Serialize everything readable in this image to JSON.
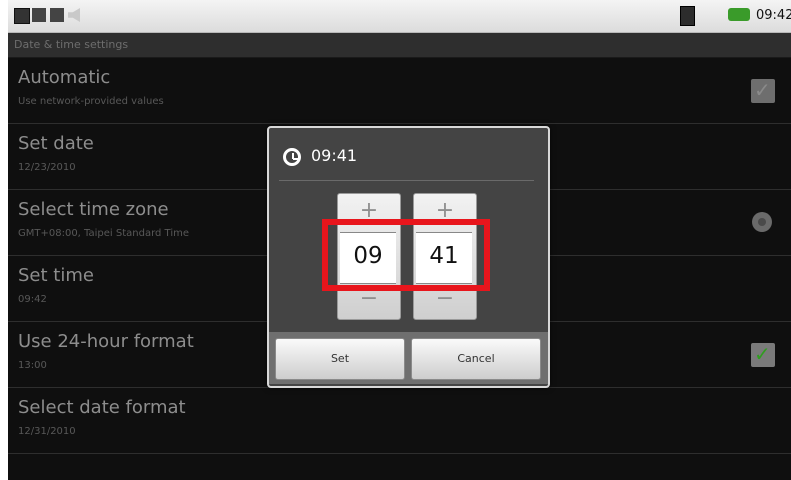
{
  "status_bar": {
    "time": "09:42",
    "icons": [
      "notification-icon",
      "usb-icon",
      "usb-debug-icon",
      "volume-icon",
      "sim-icon",
      "battery-icon"
    ]
  },
  "screen": {
    "title": "Date & time settings",
    "rows": [
      {
        "title": "Automatic",
        "subtitle": "Use network-provided values",
        "control": "checkbox",
        "checked": false
      },
      {
        "title": "Set date",
        "subtitle": "12/23/2010"
      },
      {
        "title": "Select time zone",
        "subtitle": "GMT+08:00, Taipei Standard Time",
        "control": "radio"
      },
      {
        "title": "Set time",
        "subtitle": "09:42"
      },
      {
        "title": "Use 24-hour format",
        "subtitle": "13:00",
        "control": "checkbox",
        "checked": true
      },
      {
        "title": "Select date format",
        "subtitle": "12/31/2010"
      }
    ]
  },
  "dialog": {
    "title": "09:41",
    "hours": {
      "plus": "+",
      "value": "09",
      "minus": "−"
    },
    "minutes": {
      "plus": "+",
      "value": "41",
      "minus": "−"
    },
    "set_label": "Set",
    "cancel_label": "Cancel"
  },
  "colors": {
    "highlight": "#e8151c",
    "checkbox_tick": "#2f9d1f",
    "background": "#0f0f0f"
  }
}
